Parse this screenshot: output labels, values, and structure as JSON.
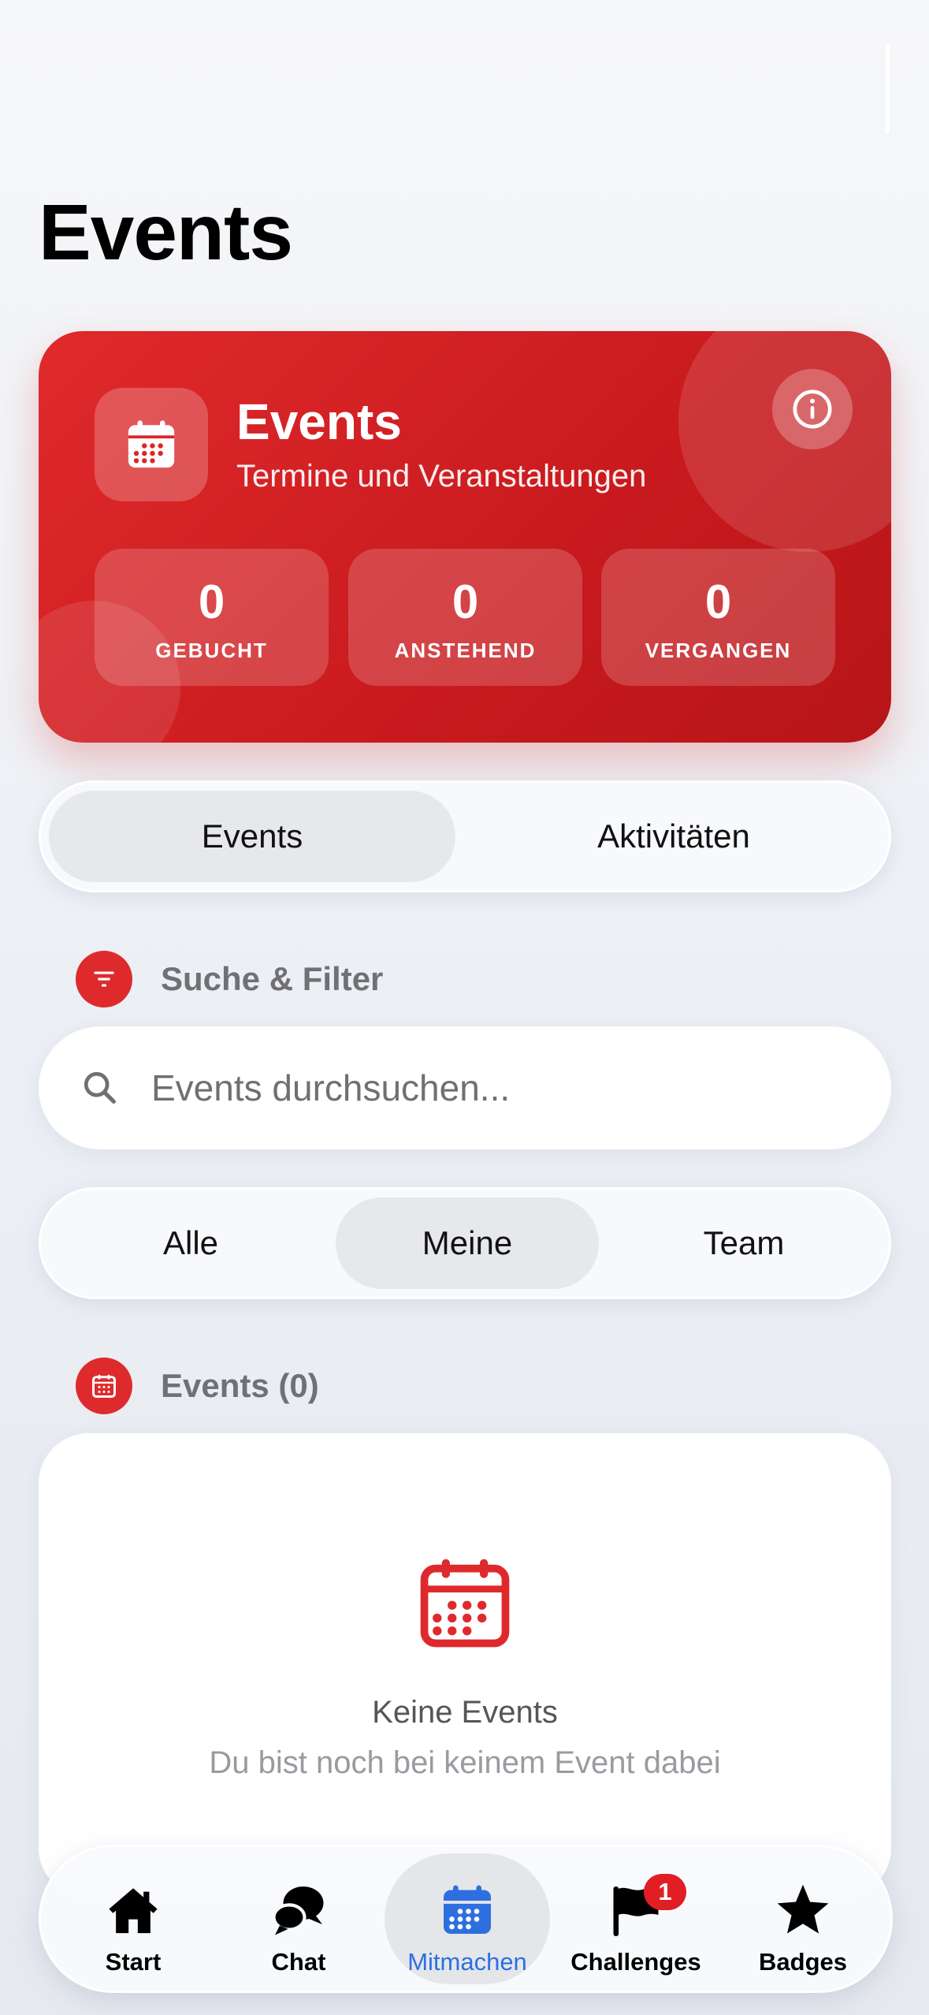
{
  "page": {
    "title": "Events"
  },
  "hero": {
    "title": "Events",
    "subtitle": "Termine und Veranstaltungen",
    "icon": "calendar-icon",
    "stats": [
      {
        "value": "0",
        "label": "GEBUCHT"
      },
      {
        "value": "0",
        "label": "ANSTEHEND"
      },
      {
        "value": "0",
        "label": "VERGANGEN"
      }
    ]
  },
  "main_tabs": {
    "items": [
      {
        "label": "Events"
      },
      {
        "label": "Aktivitäten"
      }
    ],
    "selected": "Events"
  },
  "filter_section": {
    "title": "Suche & Filter",
    "icon": "filter-icon"
  },
  "search": {
    "placeholder": "Events durchsuchen...",
    "value": ""
  },
  "scope_tabs": {
    "items": [
      {
        "label": "Alle"
      },
      {
        "label": "Meine"
      },
      {
        "label": "Team"
      }
    ],
    "selected": "Meine"
  },
  "events_section": {
    "title": "Events (0)",
    "icon": "calendar-icon"
  },
  "empty_state": {
    "title": "Keine Events",
    "subtitle": "Du bist noch bei keinem Event dabei",
    "icon": "calendar-icon"
  },
  "tabbar": {
    "items": [
      {
        "label": "Start",
        "icon": "home-icon"
      },
      {
        "label": "Chat",
        "icon": "chat-bubbles-icon"
      },
      {
        "label": "Mitmachen",
        "icon": "calendar-icon"
      },
      {
        "label": "Challenges",
        "icon": "flag-icon",
        "badge": "1"
      },
      {
        "label": "Badges",
        "icon": "star-icon"
      }
    ],
    "selected": "Mitmachen"
  },
  "colors": {
    "accent": "#df2a2d",
    "tab_active": "#2e6fe0",
    "badge": "#e01e23"
  }
}
